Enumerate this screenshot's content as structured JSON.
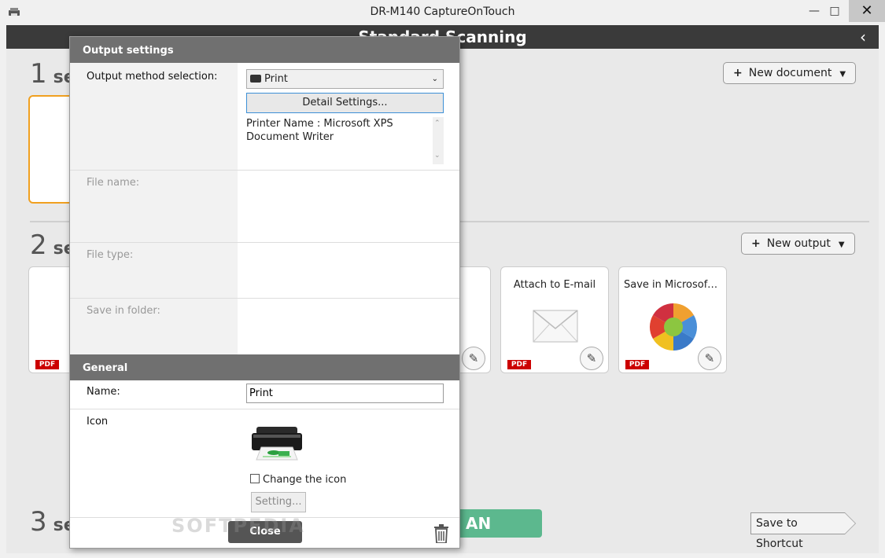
{
  "window": {
    "title": "DR-M140 CaptureOnTouch",
    "minimize": "—",
    "maximize": "□",
    "close": "✕"
  },
  "app": {
    "title": "Standard Scanning",
    "back": "‹"
  },
  "steps": [
    {
      "num": "1",
      "text": "se"
    },
    {
      "num": "2",
      "text": "se"
    },
    {
      "num": "3",
      "text": "se"
    }
  ],
  "buttons": {
    "new_document": "New document",
    "new_output": "New output",
    "save_shortcut": "Save to Shortcut",
    "scan": "AN"
  },
  "output_cards": [
    {
      "label": "",
      "badge": "PDF"
    },
    {
      "label": "Attach to E-mail",
      "badge": "PDF"
    },
    {
      "label": "Save in Microsoft S...",
      "badge": "PDF"
    }
  ],
  "dialog": {
    "output_settings_header": "Output settings",
    "output_method_label": "Output method selection:",
    "output_method_value": "Print",
    "detail_settings": "Detail Settings...",
    "printer_info": "Printer Name : Microsoft XPS Document Writer",
    "file_name_label": "File name:",
    "file_type_label": "File type:",
    "save_folder_label": "Save in folder:",
    "general_header": "General",
    "name_label": "Name:",
    "name_value": "Print",
    "icon_label": "Icon",
    "change_icon": "Change the icon",
    "setting_btn": "Setting...",
    "close_btn": "Close"
  },
  "watermark": "SOFTPEDIA",
  "colors": {
    "header_dark": "#3a3a3a",
    "section_gray": "#707070",
    "scan_green": "#5cb88e",
    "card_orange": "#f0a020",
    "pdf_red": "#cc0000"
  }
}
